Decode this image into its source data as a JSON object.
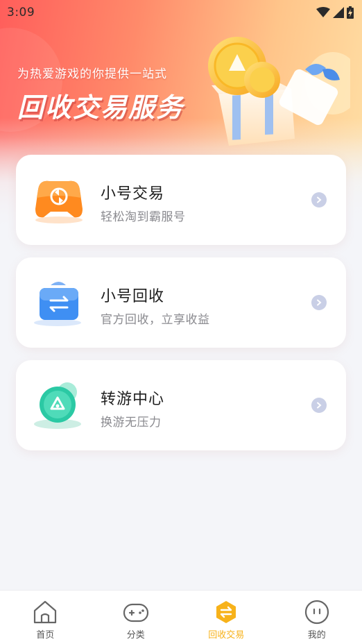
{
  "status_bar": {
    "time": "3:09"
  },
  "banner": {
    "subtitle": "为热爱游戏的你提供一站式",
    "title": "回收交易服务"
  },
  "services": [
    {
      "title": "小号交易",
      "description": "轻松淘到霸服号",
      "icon": "gamepad-exchange-icon",
      "color": "#ff8a1f"
    },
    {
      "title": "小号回收",
      "description": "官方回收，立享收益",
      "icon": "recycle-bag-icon",
      "color": "#3f8ff3"
    },
    {
      "title": "转游中心",
      "description": "换游无压力",
      "icon": "transfer-center-icon",
      "color": "#2bc9a4"
    }
  ],
  "bottom_nav": {
    "items": [
      {
        "label": "首页",
        "icon": "home-icon"
      },
      {
        "label": "分类",
        "icon": "gamepad-icon"
      },
      {
        "label": "回收交易",
        "icon": "exchange-hexagon-icon"
      },
      {
        "label": "我的",
        "icon": "profile-face-icon"
      }
    ],
    "active_index": 2,
    "active_color": "#f7b21a"
  }
}
